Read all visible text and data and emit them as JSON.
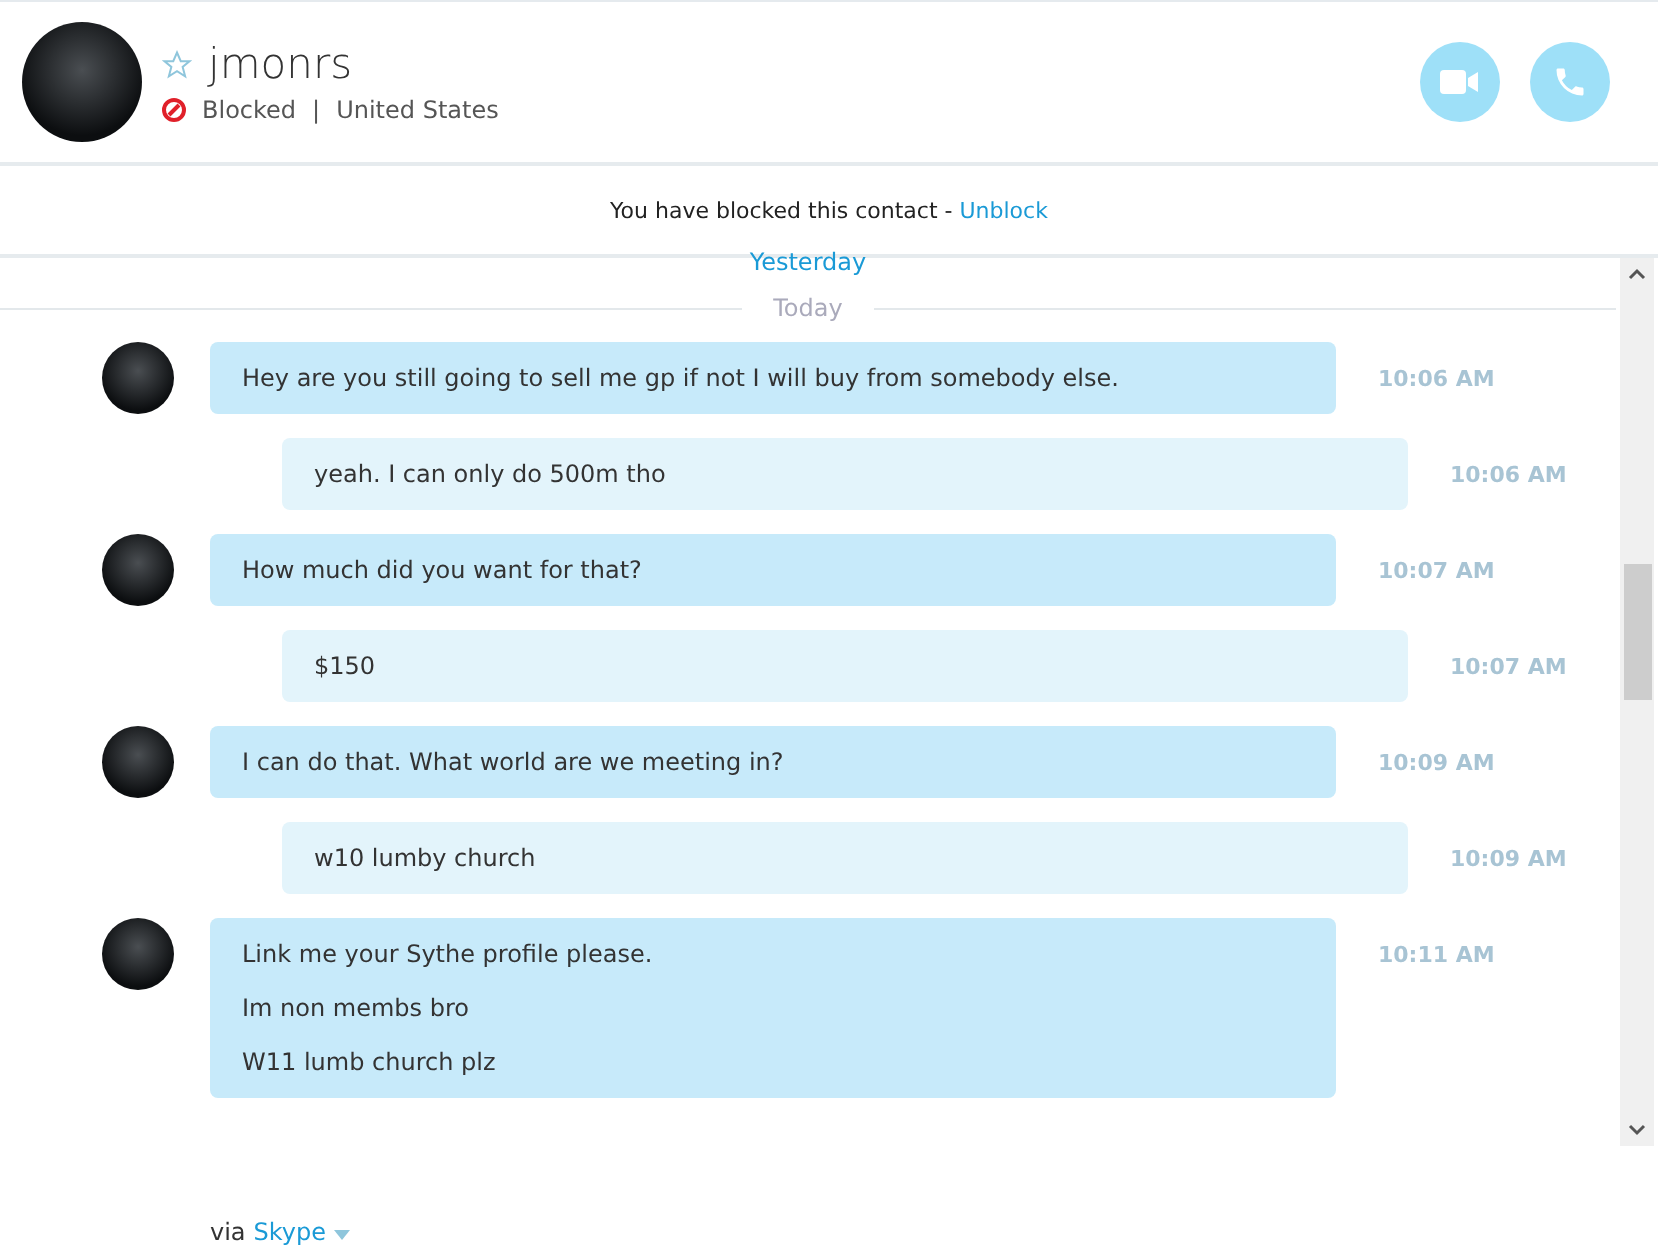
{
  "contact": {
    "name": "jmonrs",
    "favorite": false,
    "status": "Blocked",
    "separator": "|",
    "location": "United States"
  },
  "notice": {
    "text": "You have blocked this contact - ",
    "link": "Unblock"
  },
  "conversation": {
    "earlier_day": "Yesterday",
    "day": "Today",
    "messages": [
      {
        "incoming": true,
        "lines": [
          "Hey are you still going to sell me gp if not I will buy from somebody else."
        ],
        "time": "10:06 AM"
      },
      {
        "incoming": false,
        "lines": [
          "yeah. I can only do 500m tho"
        ],
        "time": "10:06 AM"
      },
      {
        "incoming": true,
        "lines": [
          "How much did you want for that?"
        ],
        "time": "10:07 AM"
      },
      {
        "incoming": false,
        "lines": [
          "$150"
        ],
        "time": "10:07 AM"
      },
      {
        "incoming": true,
        "lines": [
          "I can do that. What world are we meeting in?"
        ],
        "time": "10:09 AM"
      },
      {
        "incoming": false,
        "lines": [
          "w10 lumby church"
        ],
        "time": "10:09 AM"
      },
      {
        "incoming": true,
        "lines": [
          "Link me your Sythe profile please.",
          "Im non membs bro",
          "W11 lumb church plz"
        ],
        "time": "10:11 AM"
      }
    ]
  },
  "footer": {
    "prefix": "via",
    "service": "Skype"
  }
}
